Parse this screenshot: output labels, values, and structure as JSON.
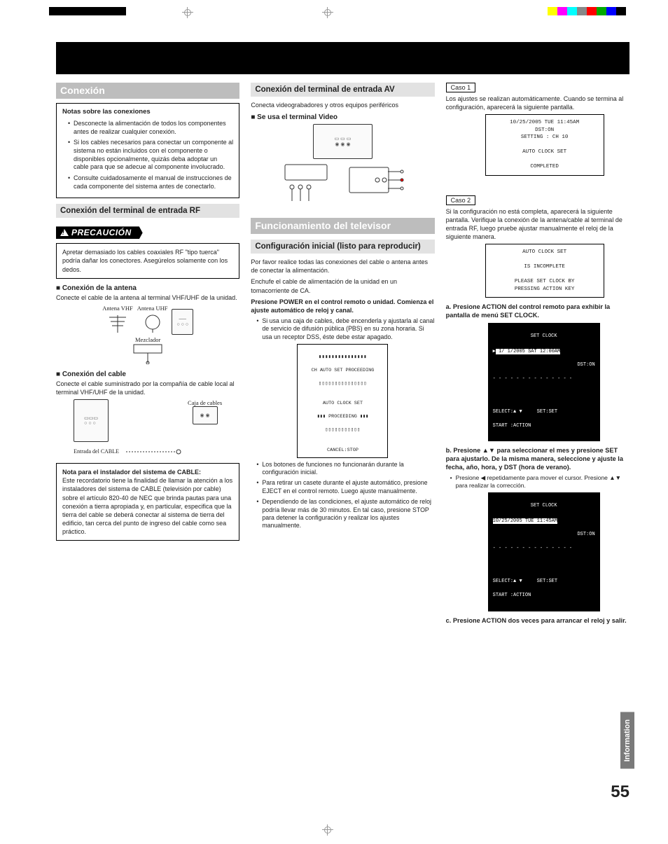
{
  "swatches": [
    "#ffff00",
    "#ff00ff",
    "#00ffff",
    "#888888",
    "#ff0000",
    "#00aa00",
    "#0000ff",
    "#000000"
  ],
  "col1": {
    "conexion": "Conexión",
    "notas_title": "Notas sobre las conexiones",
    "notas": [
      "Desconecte la alimentación de todos los componentes antes de realizar cualquier conexión.",
      "Si los cables necesarios para conectar un componente al sistema no están incluidos con el componente o disponibles opcionalmente, quizás deba adoptar un cable para que se adecue al componente involucrado.",
      "Consulte cuidadosamente el manual de instrucciones de cada componente del sistema antes de conectarlo."
    ],
    "rf_heading": "Conexión del terminal de entrada RF",
    "precaucion": "PRECAUCIÓN",
    "precaucion_body": "Apretar demasiado los cables coaxiales RF \"tipo tuerca\" podría dañar los conectores. Asegúrelos solamente con los dedos.",
    "antena_head": "Conexión de la antena",
    "antena_body": "Conecte el cable de la antena al terminal VHF/UHF de la unidad.",
    "dia_vhf": "Antena VHF",
    "dia_uhf": "Antena UHF",
    "dia_mezclador": "Mezclador",
    "cable_head": "Conexión del cable",
    "cable_body": "Conecte el cable suministrado por la compañía de cable local al terminal VHF/UHF de la unidad.",
    "dia_caja": "Caja de cables",
    "dia_entrada": "Entrada del CABLE",
    "nota_instal_title": "Nota  para el instalador del sistema de CABLE:",
    "nota_instal_body": "Este recordatorio tiene la finalidad de llamar la atención a los instaladores del sistema de CABLE (televisión por cable) sobre el artículo 820-40 de NEC que brinda pautas para una conexión a tierra apropiada y, en particular, especifica que la tierra del cable se deberá conectar al sistema de tierra del edificio, tan cerca del punto de ingreso del cable como sea práctico."
  },
  "col2": {
    "av_heading": "Conexión del terminal de entrada AV",
    "av_body": "Conecta videograbadores y otros equipos periféricos",
    "video_head": "Se usa el terminal Video",
    "func_heading": "Funcionamiento del televisor",
    "config_heading": "Configuración inicial (listo para reproducir)",
    "p1": "Por favor realice todas las conexiones del cable o antena antes de conectar la alimentación.",
    "p2": "Enchufe el cable de alimentación de la unidad en un tomacorriente de CA.",
    "p3": "Presione POWER en el control remoto o unidad. Comienza el ajuste automático de reloj y canal.",
    "b1": "Si usa una caja de cables, debe encenderla y ajustarla al canal de servicio de difusión pública (PBS) en su zona horaria. Si usa un receptor DSS, éste debe estar apagado.",
    "screen1_l1": "CH AUTO SET PROCEEDING",
    "screen1_l2": "AUTO CLOCK SET",
    "screen1_l3": "PROCEEDING",
    "screen1_l4": "CANCEL:STOP",
    "b2": "Los botones de funciones no funcionarán durante la configuración inicial.",
    "b3": "Para retirar un casete durante el ajuste automático, presione EJECT en el control remoto. Luego ajuste manualmente.",
    "b4": "Dependiendo de las condiciones, el ajuste automático de reloj podría llevar más de 30 minutos. En tal caso, presione STOP para detener la configuración y realizar los ajustes manualmente."
  },
  "col3": {
    "caso1": "Caso 1",
    "caso1_body": "Los ajustes se realizan automáticamente. Cuando se termina al configuración, aparecerá la siguiente pantalla.",
    "screenA": "10/25/2005 TUE 11:45AM\nDST:ON\nSETTING : CH 10\n\nAUTO CLOCK SET\n\nCOMPLETED",
    "caso2": "Caso 2",
    "caso2_body": "Si la configuración no está completa, aparecerá la siguiente pantalla. Verifique la conexión de la antena/cable al terminal de entrada RF, luego pruebe ajustar manualmente el reloj de la siguiente manera.",
    "screenB": "AUTO CLOCK SET\n\nIS INCOMPLETE\n\nPLEASE SET CLOCK BY\nPRESSING ACTION KEY",
    "step_a": "a. Presione ACTION del control remoto para exhibir la pantalla de menú SET CLOCK.",
    "bwA_title": "SET CLOCK",
    "bwA_row": " 1/ 1/2005 SAT 12:00AM",
    "bwA_dst": "DST:ON",
    "bwA_sel": "SELECT:▲ ▼     SET:SET",
    "bwA_start": "START :ACTION",
    "step_b": "b. Presione ▲▼ para seleccionar el mes y presione SET para ajustarlo. De la misma manera, seleccione y ajuste la fecha, año, hora, y DST (hora de verano).",
    "step_b_sub": "Presione ◀ repetidamente para mover el cursor. Presione ▲▼ para realizar la corrección.",
    "bwB_row": "10/25/2005 TUE 11:45AM",
    "step_c": "c. Presione ACTION dos veces para arrancar el reloj y salir."
  },
  "info_tab": "Information",
  "page_num": "55"
}
